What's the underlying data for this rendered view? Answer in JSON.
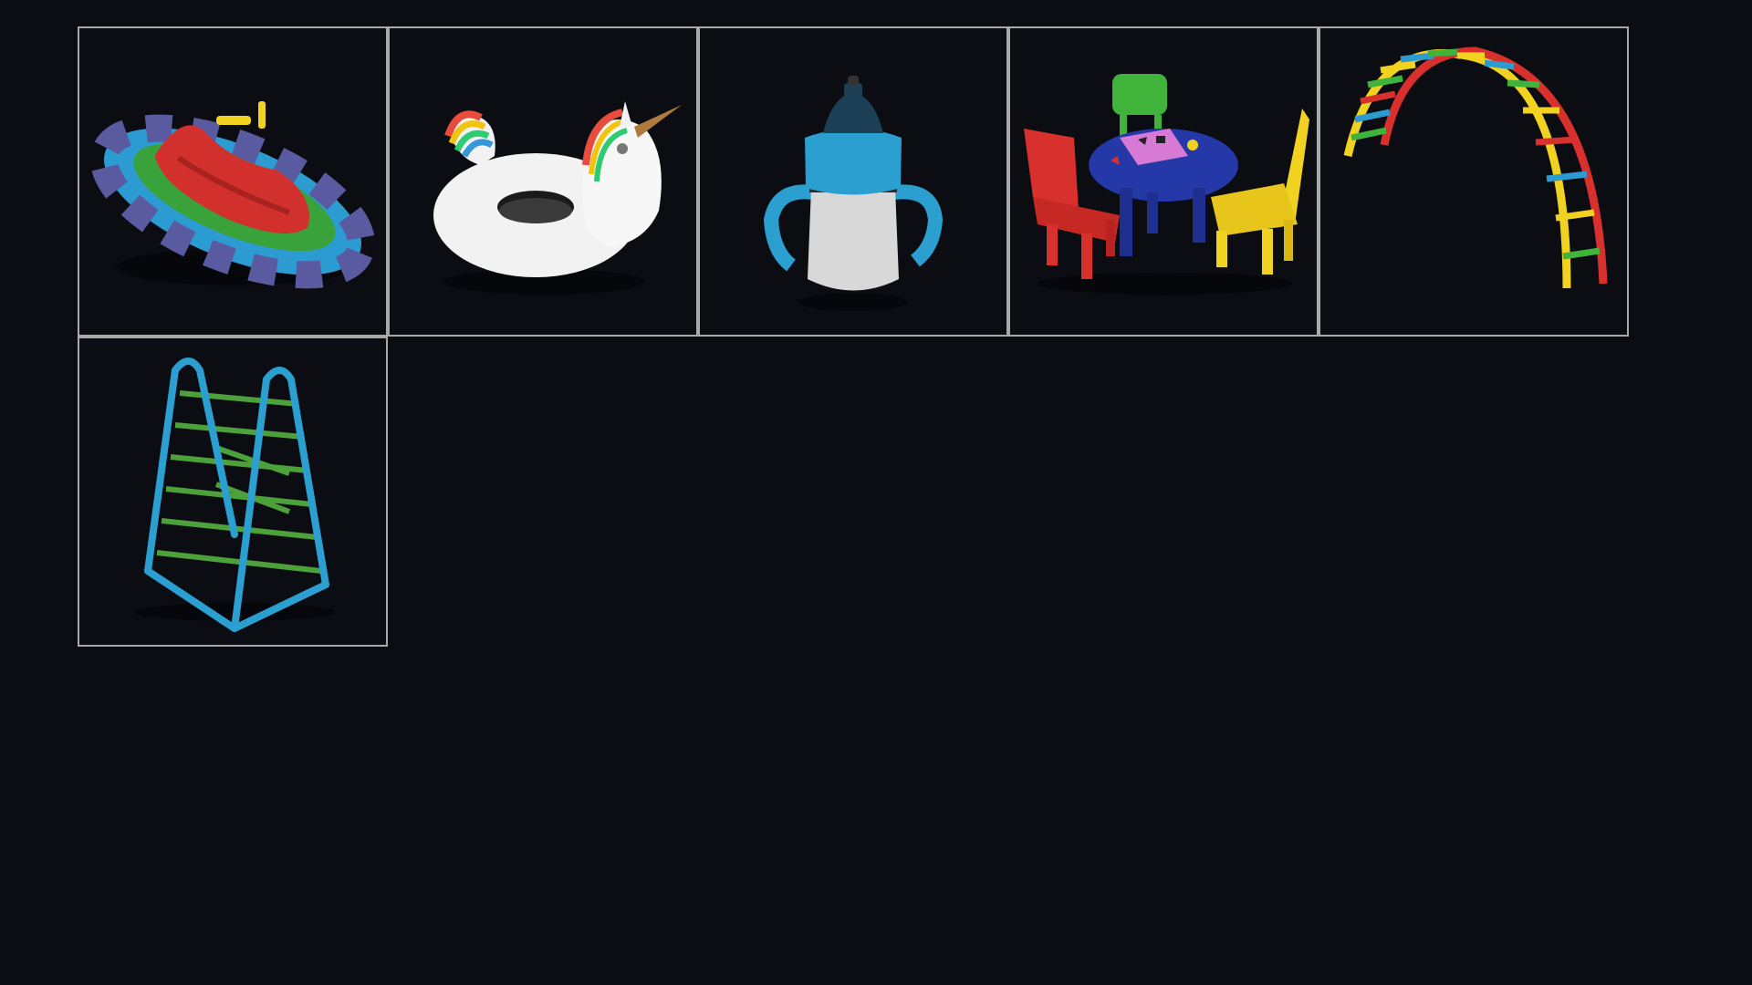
{
  "grid": {
    "background": "#0b0d13",
    "border_color": "#a9a9a9",
    "columns": 5,
    "items": [
      {
        "name": "bumper-boat",
        "icon": "bumper-boat-icon",
        "colors": [
          "#d1302d",
          "#3aa23a",
          "#2c9bd1",
          "#5a5aa0"
        ]
      },
      {
        "name": "unicorn-pool-float",
        "icon": "unicorn-float-icon",
        "colors": [
          "#f2f2f2",
          "#e74c3c",
          "#f1c40f",
          "#2ecc71",
          "#3498db",
          "#b07a3c"
        ]
      },
      {
        "name": "sippy-cup",
        "icon": "sippy-cup-icon",
        "colors": [
          "#2a9fd0",
          "#d8d8d8",
          "#1d3f55"
        ]
      },
      {
        "name": "kids-table-and-chairs",
        "icon": "table-chairs-icon",
        "colors": [
          "#2438a8",
          "#d8302c",
          "#f2d221",
          "#3fb33a",
          "#d67ad6"
        ]
      },
      {
        "name": "arch-climbing-ladder",
        "icon": "arch-ladder-icon",
        "colors": [
          "#d8302c",
          "#f2d221",
          "#3fb33a",
          "#2c9bd1"
        ]
      },
      {
        "name": "a-frame-climber",
        "icon": "a-frame-climber-icon",
        "colors": [
          "#2a9fd0",
          "#4da13a"
        ]
      }
    ]
  }
}
